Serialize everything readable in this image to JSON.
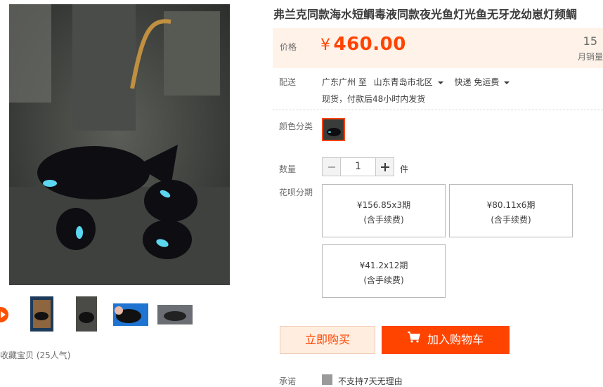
{
  "title": "弗兰克同款海水短鲷毒液同款夜光鱼灯光鱼无牙龙幼崽灯频鲷",
  "price": {
    "label": "价格",
    "currency": "¥",
    "value": "460.00"
  },
  "sales": {
    "count": "15",
    "label": "月销量"
  },
  "shipping": {
    "label": "配送",
    "from": "广东广州 至",
    "to": "山东青岛市北区",
    "method": "快递 免运费",
    "note": "现货，付款后48小时内发货"
  },
  "color": {
    "label": "颜色分类"
  },
  "quantity": {
    "label": "数量",
    "value": "1",
    "unit": "件"
  },
  "installments": {
    "label": "花呗分期",
    "options": [
      {
        "amount": "¥156.85x3期",
        "fee": "(含手续费)"
      },
      {
        "amount": "¥80.11x6期",
        "fee": "(含手续费)"
      },
      {
        "amount": "¥41.2x12期",
        "fee": "(含手续费)"
      }
    ]
  },
  "actions": {
    "buy_now": "立即购买",
    "add_cart": "加入购物车"
  },
  "promise": {
    "label": "承诺",
    "text": "不支持7天无理由"
  },
  "favorite": {
    "text": "收藏宝贝 (25人气)"
  },
  "colors": {
    "accent": "#ff4400",
    "price_bg": "#fff2e8"
  },
  "icons": [
    "play-icon",
    "cart-icon",
    "dropdown-arrow-icon",
    "minus-icon",
    "plus-icon",
    "checkbox-icon"
  ]
}
